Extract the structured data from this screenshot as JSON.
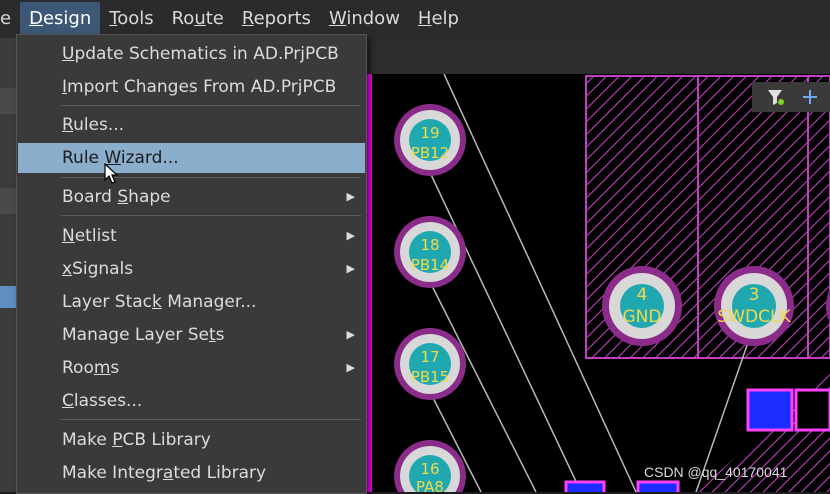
{
  "menubar": {
    "items": [
      {
        "label": "e"
      },
      {
        "label": "Design",
        "mnemonic": "D",
        "active": true
      },
      {
        "label": "Tools",
        "mnemonic": "T"
      },
      {
        "label": "Route",
        "mnemonic": "u"
      },
      {
        "label": "Reports",
        "mnemonic": "R"
      },
      {
        "label": "Window",
        "mnemonic": "W"
      },
      {
        "label": "Help",
        "mnemonic": "H"
      }
    ]
  },
  "design_menu": {
    "items": [
      {
        "label": "Update Schematics in AD.PrjPCB",
        "mnemonic": "U",
        "submenu": false
      },
      {
        "label": "Import Changes From AD.PrjPCB",
        "mnemonic": "I",
        "submenu": false
      },
      {
        "label": "Rules...",
        "mnemonic": "R",
        "submenu": false
      },
      {
        "label": "Rule Wizard...",
        "mnemonic": "W",
        "submenu": false,
        "highlighted": true
      },
      {
        "label": "Board Shape",
        "mnemonic": "S",
        "submenu": true
      },
      {
        "label": "Netlist",
        "mnemonic": "N",
        "submenu": true
      },
      {
        "label": "xSignals",
        "mnemonic": "x",
        "submenu": true
      },
      {
        "label": "Layer Stack Manager...",
        "mnemonic": "k",
        "submenu": false
      },
      {
        "label": "Manage Layer Sets",
        "mnemonic": "t",
        "submenu": true
      },
      {
        "label": "Rooms",
        "mnemonic": "m",
        "submenu": true
      },
      {
        "label": "Classes...",
        "mnemonic": "C",
        "submenu": false
      },
      {
        "label": "Make PCB Library",
        "mnemonic": "P",
        "submenu": false
      },
      {
        "label": "Make Integrated Library",
        "mnemonic": "a",
        "submenu": false
      }
    ]
  },
  "pcb": {
    "pads": [
      {
        "number": "19",
        "net": "PB12"
      },
      {
        "number": "18",
        "net": "PB14"
      },
      {
        "number": "17",
        "net": "PB15"
      },
      {
        "number": "16",
        "net": "PA8"
      },
      {
        "number": "4",
        "net": "GND"
      },
      {
        "number": "3",
        "net": "SWDCLK"
      }
    ]
  },
  "watermark": "CSDN @qq_40170041",
  "colors": {
    "menu_bg": "#3a3a3a",
    "highlight": "#8aaecc",
    "pad_ring": "#8b2c8b",
    "pad_center": "#20a8b0",
    "pad_text": "#f2d94a",
    "hatch": "#c040c0",
    "board_edge": "#ff00ff",
    "smd_fill": "#1a2cff"
  }
}
